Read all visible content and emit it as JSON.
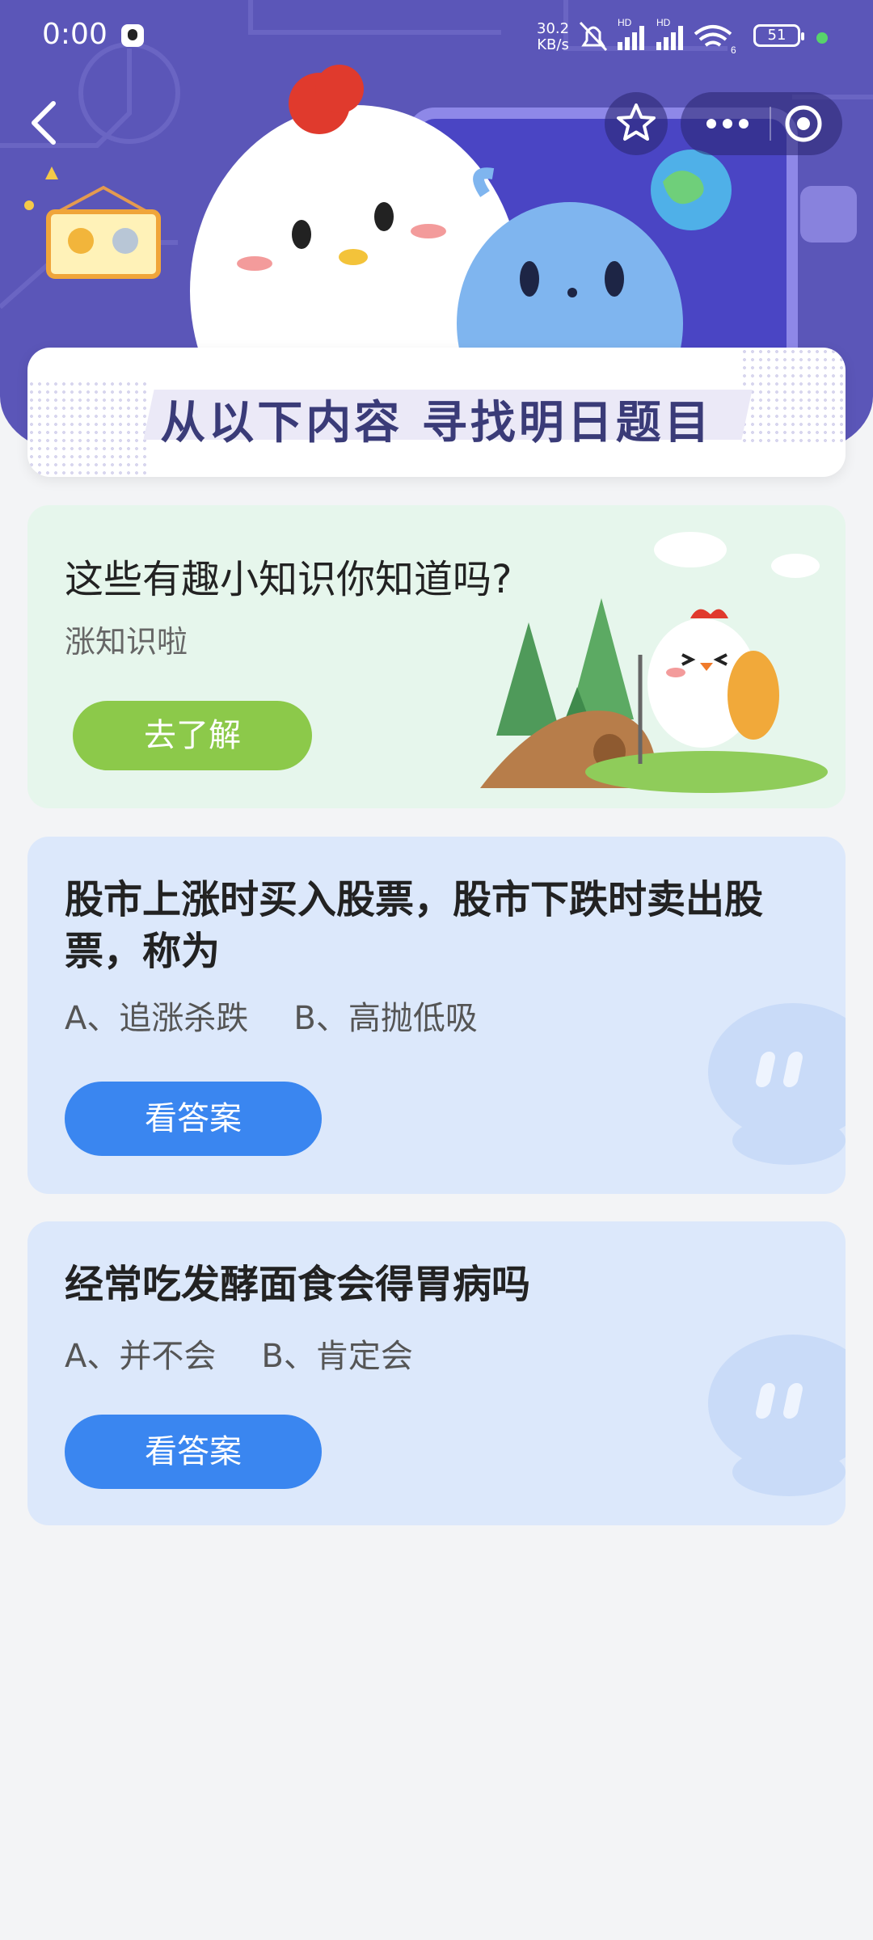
{
  "status_bar": {
    "time": "0:00",
    "speed_value": "30.2",
    "speed_unit": "KB/s",
    "signal_label_1": "HD",
    "signal_label_2": "HD",
    "wifi_label": "6",
    "battery": "51"
  },
  "header": {
    "banner_title": "从以下内容 寻找明日题目"
  },
  "knowledge_card": {
    "title": "这些有趣小知识你知道吗?",
    "subtitle": "涨知识啦",
    "button_label": "去了解"
  },
  "questions": [
    {
      "title": "股市上涨时买入股票，股市下跌时卖出股票，称为",
      "option_a": "A、追涨杀跌",
      "option_b": "B、高抛低吸",
      "button_label": "看答案"
    },
    {
      "title": "经常吃发酵面食会得胃病吗",
      "option_a": "A、并不会",
      "option_b": "B、肯定会",
      "button_label": "看答案"
    }
  ],
  "icons": {
    "back": "chevron-left-icon",
    "favorite": "star-icon",
    "more": "more-dots-icon",
    "close": "target-circle-icon"
  },
  "colors": {
    "header_bg": "#5b56b8",
    "primary_blue": "#3a86f0",
    "green_button": "#8cc94a",
    "card_green": "#e6f6ec",
    "card_blue": "#dce8fb"
  }
}
